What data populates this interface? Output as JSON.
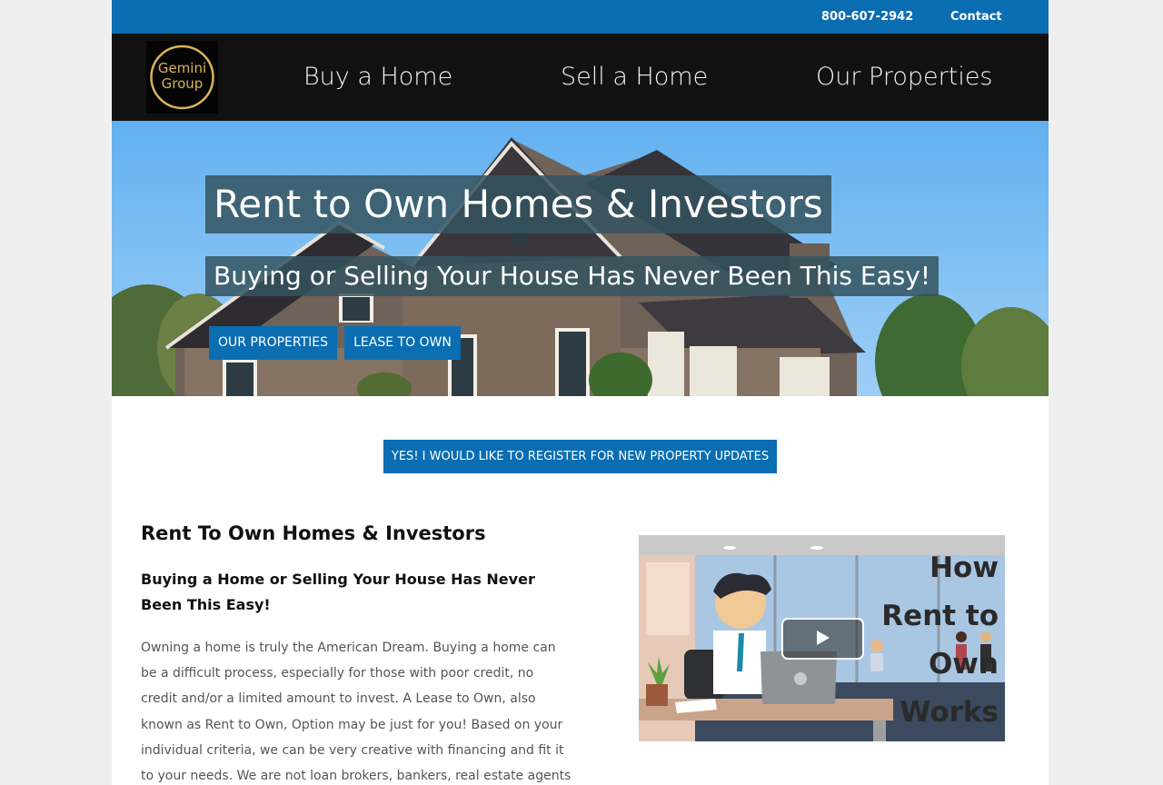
{
  "topbar": {
    "phone": "800-607-2942",
    "contact": "Contact"
  },
  "logo": {
    "text_line1": "Gemini",
    "text_line2": "Group",
    "accent_color": "#d9b35a"
  },
  "nav": {
    "items": [
      {
        "label": "Buy a Home"
      },
      {
        "label": "Sell a Home"
      },
      {
        "label": "Our Properties"
      }
    ]
  },
  "hero": {
    "title": "Rent to Own Homes & Investors",
    "subtitle": "Buying or Selling Your House Has Never Been This Easy!",
    "buttons": [
      {
        "label": "Our Properties"
      },
      {
        "label": "Lease to Own"
      }
    ]
  },
  "register": {
    "label": "Yes! I Would Like to Register for New Property Updates"
  },
  "content": {
    "title": "Rent To Own Homes & Investors",
    "subtitle": "Buying a Home or Selling Your House Has Never Been This Easy!",
    "body": "Owning a home is truly the American Dream. Buying a home can be a difficult process, especially for those with poor credit, no credit and/or a limited amount to invest. A Lease to Own, also known as Rent to Own, Option may be just for you! Based on your individual criteria, we can be very creative with financing and fit it to your needs. We are not loan brokers, bankers, real estate agents or selling homes for someone else,"
  },
  "video": {
    "caption": "How Rent to Own Works",
    "play_icon": "play-icon"
  },
  "colors": {
    "brand_blue": "#0b6db2",
    "nav_bg": "#111111",
    "page_bg": "#efefef"
  }
}
